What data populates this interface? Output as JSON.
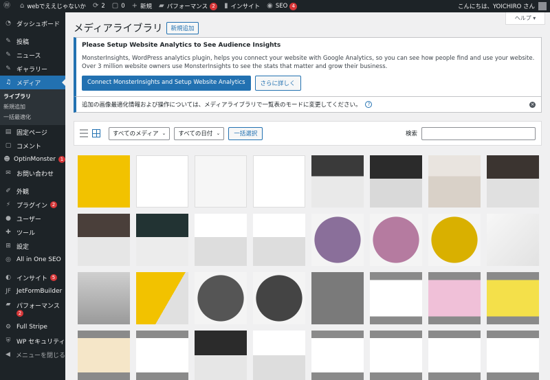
{
  "adminbar": {
    "site_name": "webでええじゃないか",
    "updates_count": "2",
    "comments_count": "0",
    "new_label": "新規",
    "performance_label": "パフォーマンス",
    "performance_badge": "2",
    "insights_label": "インサイト",
    "seo_label": "SEO",
    "seo_badge": "4",
    "greeting": "こんにちは、YOICHIRO さん"
  },
  "sidebar": {
    "dashboard": "ダッシュボード",
    "posts": "投稿",
    "news": "ニュース",
    "gallery": "ギャラリー",
    "media": "メディア",
    "media_sub": {
      "library": "ライブラリ",
      "add_new": "新規追加",
      "bulk_optimize": "一括最適化"
    },
    "pages": "固定ページ",
    "comments": "コメント",
    "optinmonster": "OptinMonster",
    "optinmonster_badge": "1",
    "contact": "お問い合わせ",
    "appearance": "外観",
    "plugins": "プラグイン",
    "plugins_badge": "2",
    "users": "ユーザー",
    "tools": "ツール",
    "settings": "設定",
    "aioseo": "All in One SEO",
    "insights": "インサイト",
    "insights_badge": "5",
    "jetformbuilder": "JetFormBuilder",
    "performance": "パフォーマンス",
    "performance_badge": "2",
    "fullstripe": "Full Stripe",
    "wpsecurity": "WP セキュリティ",
    "collapse": "メニューを閉じる"
  },
  "page": {
    "title": "メディアライブラリ",
    "add_new": "新規追加",
    "help_tab": "ヘルプ ▾"
  },
  "notice_monsterinsights": {
    "heading": "Please Setup Website Analytics to See Audience Insights",
    "body": "MonsterInsights, WordPress analytics plugin, helps you connect your website with Google Analytics, so you can see how people find and use your website. Over 3 million website owners use MonsterInsights to see the stats that matter and grow their business.",
    "primary_button": "Connect MonsterInsights and Setup Website Analytics",
    "secondary_button": "さらに詳しく"
  },
  "notice_optimize": {
    "text": "追加の画像最適化情報および操作については、メディアライブラリで一覧表のモードに変更してください。",
    "help": "?",
    "dismiss": "×"
  },
  "toolbar": {
    "filter_media": "すべてのメディア",
    "filter_date": "すべての日付",
    "bulk_select": "一括選択",
    "search_label": "検索"
  },
  "colors": {
    "adminbar_bg": "#1d2327",
    "sidebar_bg": "#1d2327",
    "accent": "#2271b1",
    "badge": "#d63638"
  },
  "tile_count": 36
}
